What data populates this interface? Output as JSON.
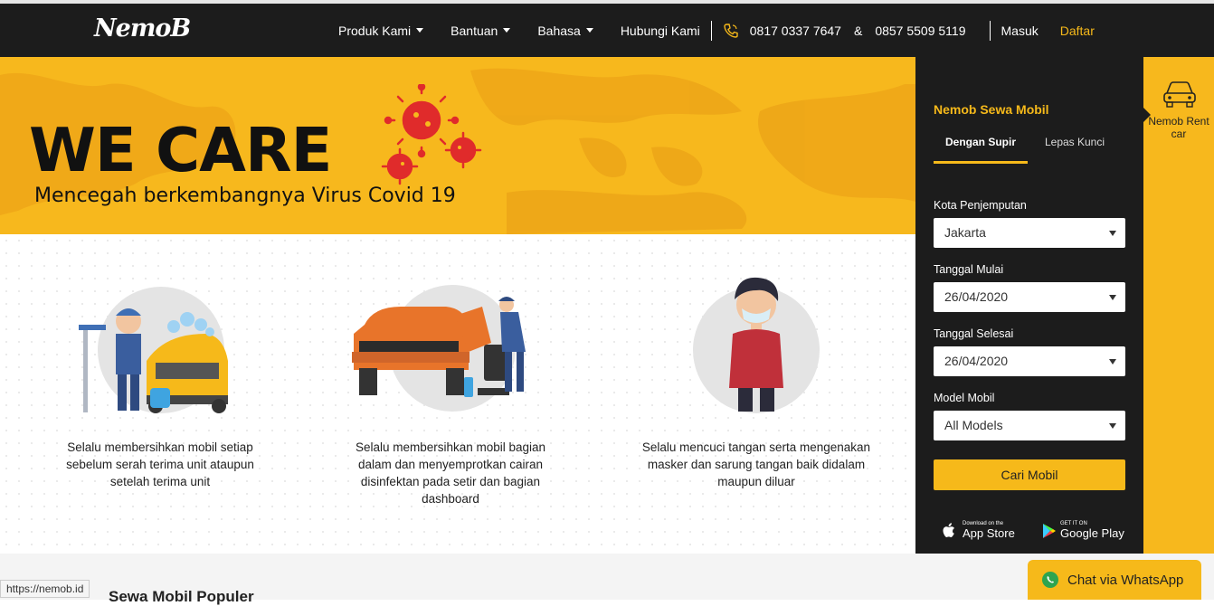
{
  "header": {
    "logo_text": "NemoB",
    "nav": [
      {
        "label": "Produk Kami",
        "has_dropdown": true
      },
      {
        "label": "Bantuan",
        "has_dropdown": true
      },
      {
        "label": "Bahasa",
        "has_dropdown": true
      },
      {
        "label": "Hubungi Kami",
        "has_dropdown": false
      }
    ],
    "phone_1": "0817 0337 7647",
    "phone_sep": "&",
    "phone_2": "0857 5509 5119",
    "login": "Masuk",
    "register": "Daftar",
    "phone_icon": "phone-icon"
  },
  "hero": {
    "title": "WE CARE",
    "subtitle": "Mencegah berkembangnya Virus Covid 19"
  },
  "cards": [
    {
      "text": "Selalu membersihkan mobil setiap sebelum serah terima unit ataupun setelah terima unit",
      "image": "car-wash-illustration"
    },
    {
      "text": "Selalu membersihkan mobil bagian dalam dan menyemprotkan cairan disinfektan pada setir dan bagian dashboard",
      "image": "car-disinfect-illustration"
    },
    {
      "text": "Selalu mencuci tangan serta mengenakan masker dan sarung tangan baik didalam maupun diluar",
      "image": "masked-person-illustration"
    }
  ],
  "booking": {
    "title": "Nemob Sewa Mobil",
    "tabs": [
      "Dengan Supir",
      "Lepas Kunci"
    ],
    "active_tab": "Dengan Supir",
    "fields": [
      {
        "label": "Kota Penjemputan",
        "value": "Jakarta"
      },
      {
        "label": "Tanggal Mulai",
        "value": "26/04/2020"
      },
      {
        "label": "Tanggal Selesai",
        "value": "26/04/2020"
      },
      {
        "label": "Model Mobil",
        "value": "All Models"
      }
    ],
    "search_button": "Cari Mobil",
    "app_store": {
      "small": "Download on the",
      "big": "App Store"
    },
    "google_play": {
      "small": "GET IT ON",
      "big": "Google Play"
    }
  },
  "rent_tab": {
    "label": "Nemob Rent car",
    "icon": "car-icon"
  },
  "bottom": {
    "section_title": "Sewa Mobil Populer"
  },
  "status_url": "https://nemob.id",
  "whatsapp": {
    "label": "Chat via WhatsApp",
    "icon": "whatsapp-icon"
  },
  "colors": {
    "accent": "#f6b91a",
    "dark": "#1c1c1c",
    "virus": "#e02b2b"
  }
}
